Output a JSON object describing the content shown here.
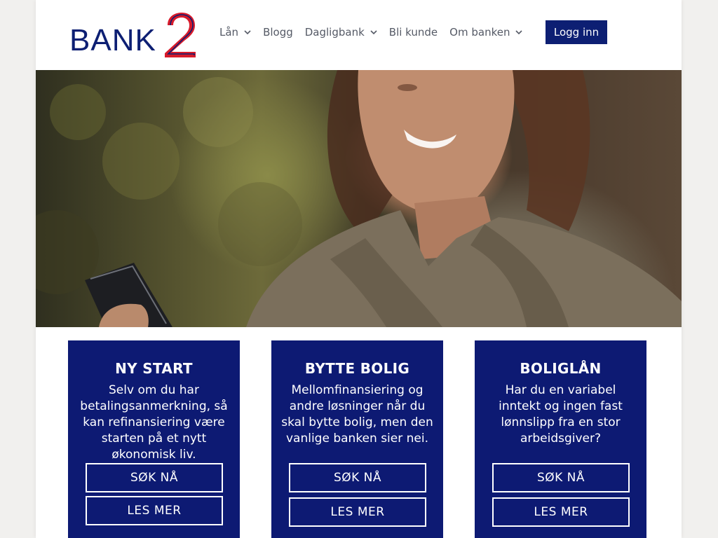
{
  "brand": {
    "logo_text": "BANK",
    "logo_mark": "2",
    "primary_color": "#0d1a73",
    "accent_color": "#d71a2a"
  },
  "nav": {
    "items": [
      {
        "label": "Lån",
        "has_dropdown": true
      },
      {
        "label": "Blogg",
        "has_dropdown": false
      },
      {
        "label": "Dagligbank",
        "has_dropdown": true
      },
      {
        "label": "Bli kunde",
        "has_dropdown": false
      },
      {
        "label": "Om banken",
        "has_dropdown": true
      }
    ],
    "login_label": "Logg inn"
  },
  "hero": {
    "image": "woman-smiling-at-phone"
  },
  "cards": [
    {
      "title": "NY START",
      "text": "Selv om du har betalingsanmerkning, så kan refinansiering være starten på et nytt økonomisk liv.",
      "primary_button": "SØK NÅ",
      "secondary_button": "LES MER"
    },
    {
      "title": "BYTTE BOLIG",
      "text": "Mellomfinansiering og andre løsninger når du skal bytte bolig, men den vanlige banken sier nei.",
      "primary_button": "SØK NÅ",
      "secondary_button": "LES MER"
    },
    {
      "title": "BOLIGLÅN",
      "text": "Har du en variabel inntekt og ingen fast lønnslipp fra en stor arbeidsgiver?",
      "primary_button": "SØK NÅ",
      "secondary_button": "LES MER"
    }
  ]
}
